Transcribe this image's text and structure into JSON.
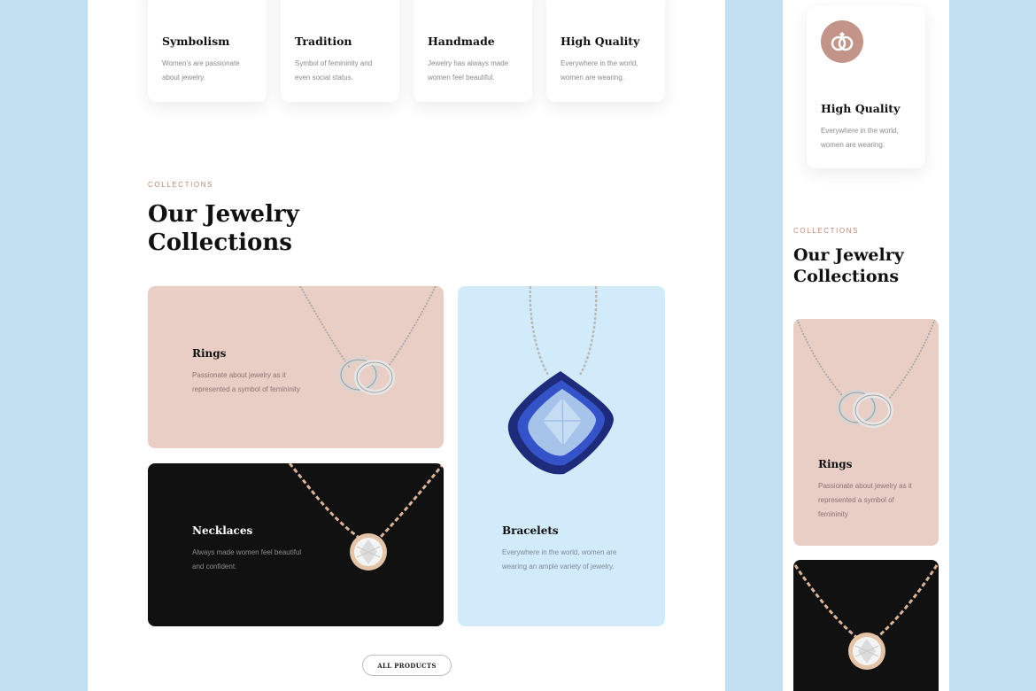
{
  "features": [
    {
      "title": "Symbolism",
      "desc": "Women's are passionate about jewelry."
    },
    {
      "title": "Tradition",
      "desc": "Symbol of femininity and even social status."
    },
    {
      "title": "Handmade",
      "desc": "Jewelry has always made women feel beautiful."
    },
    {
      "title": "High Quality",
      "desc": "Everywhere in the world, women are wearing."
    }
  ],
  "collections": {
    "eyebrow": "COLLECTIONS",
    "heading_line1": "Our Jewelry",
    "heading_line2": "Collections",
    "tiles": {
      "rings": {
        "title": "Rings",
        "desc": "Passionate about jewelry as it represented a symbol of femininity"
      },
      "necklaces": {
        "title": "Necklaces",
        "desc": "Always made women feel beautiful and confident."
      },
      "bracelets": {
        "title": "Bracelets",
        "desc": "Everywhere in the world, women are wearing an ample variety of jewelry."
      }
    },
    "all_products_label": "ALL PRODUCTS"
  },
  "mobile": {
    "feature": {
      "title": "High Quality",
      "desc": "Everywhere in the world, women are wearing."
    },
    "eyebrow": "COLLECTIONS",
    "heading_line1": "Our Jewelry",
    "heading_line2": "Collections",
    "rings": {
      "title": "Rings",
      "desc": "Passionate about jewelry as it represented a symbol of femininity"
    }
  },
  "colors": {
    "background": "#c2dff2",
    "rings_tile": "#e9cec6",
    "necklaces_tile": "#111111",
    "bracelets_tile": "#d1ebfa",
    "accent": "#c0876f",
    "icon_circle": "#c39489"
  },
  "icons": {
    "mobile_feature": "rings-icon"
  }
}
